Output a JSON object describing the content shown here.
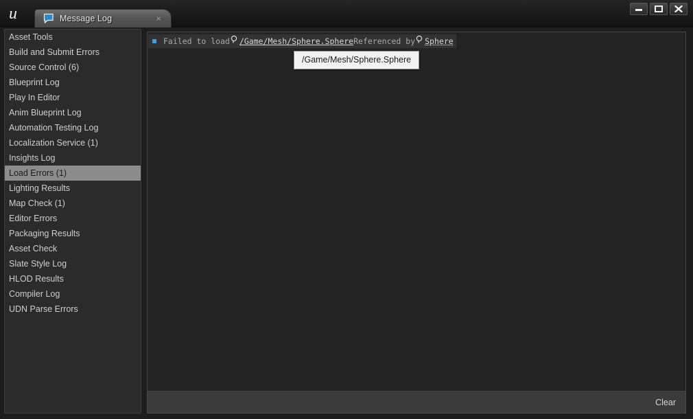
{
  "window": {
    "logo_icon": "unreal-engine-logo",
    "controls": [
      {
        "name": "minimize-button",
        "icon": "minimize-icon"
      },
      {
        "name": "maximize-button",
        "icon": "maximize-icon"
      },
      {
        "name": "close-button",
        "icon": "close-icon"
      }
    ]
  },
  "tab": {
    "icon": "message-log-icon",
    "label": "Message Log",
    "close_label": "×"
  },
  "sidebar": {
    "items": [
      {
        "label": "Asset Tools",
        "selected": false
      },
      {
        "label": "Build and Submit Errors",
        "selected": false
      },
      {
        "label": "Source Control (6)",
        "selected": false
      },
      {
        "label": "Blueprint Log",
        "selected": false
      },
      {
        "label": "Play In Editor",
        "selected": false
      },
      {
        "label": "Anim Blueprint Log",
        "selected": false
      },
      {
        "label": "Automation Testing Log",
        "selected": false
      },
      {
        "label": "Localization Service (1)",
        "selected": false
      },
      {
        "label": "Insights Log",
        "selected": false
      },
      {
        "label": "Load Errors (1)",
        "selected": true
      },
      {
        "label": "Lighting Results",
        "selected": false
      },
      {
        "label": "Map Check (1)",
        "selected": false
      },
      {
        "label": "Editor Errors",
        "selected": false
      },
      {
        "label": "Packaging Results",
        "selected": false
      },
      {
        "label": "Asset Check",
        "selected": false
      },
      {
        "label": "Slate Style Log",
        "selected": false
      },
      {
        "label": "HLOD Results",
        "selected": false
      },
      {
        "label": "Compiler Log",
        "selected": false
      },
      {
        "label": "UDN Parse Errors",
        "selected": false
      }
    ]
  },
  "log": {
    "message": {
      "severity_icon": "info-bullet-icon",
      "part1": "Failed to load",
      "link1_icon": "search-icon",
      "link1": "/Game/Mesh/Sphere.Sphere",
      "part2": " Referenced by",
      "link2_icon": "search-icon",
      "link2": "Sphere"
    }
  },
  "tooltip": {
    "text": "/Game/Mesh/Sphere.Sphere"
  },
  "bottombar": {
    "clear_label": "Clear"
  },
  "colors": {
    "accent_blue": "#3c9fe0",
    "selection_gray": "#8c8c8c",
    "panel_bg": "#242424",
    "sidebar_bg": "#2b2b2b"
  }
}
